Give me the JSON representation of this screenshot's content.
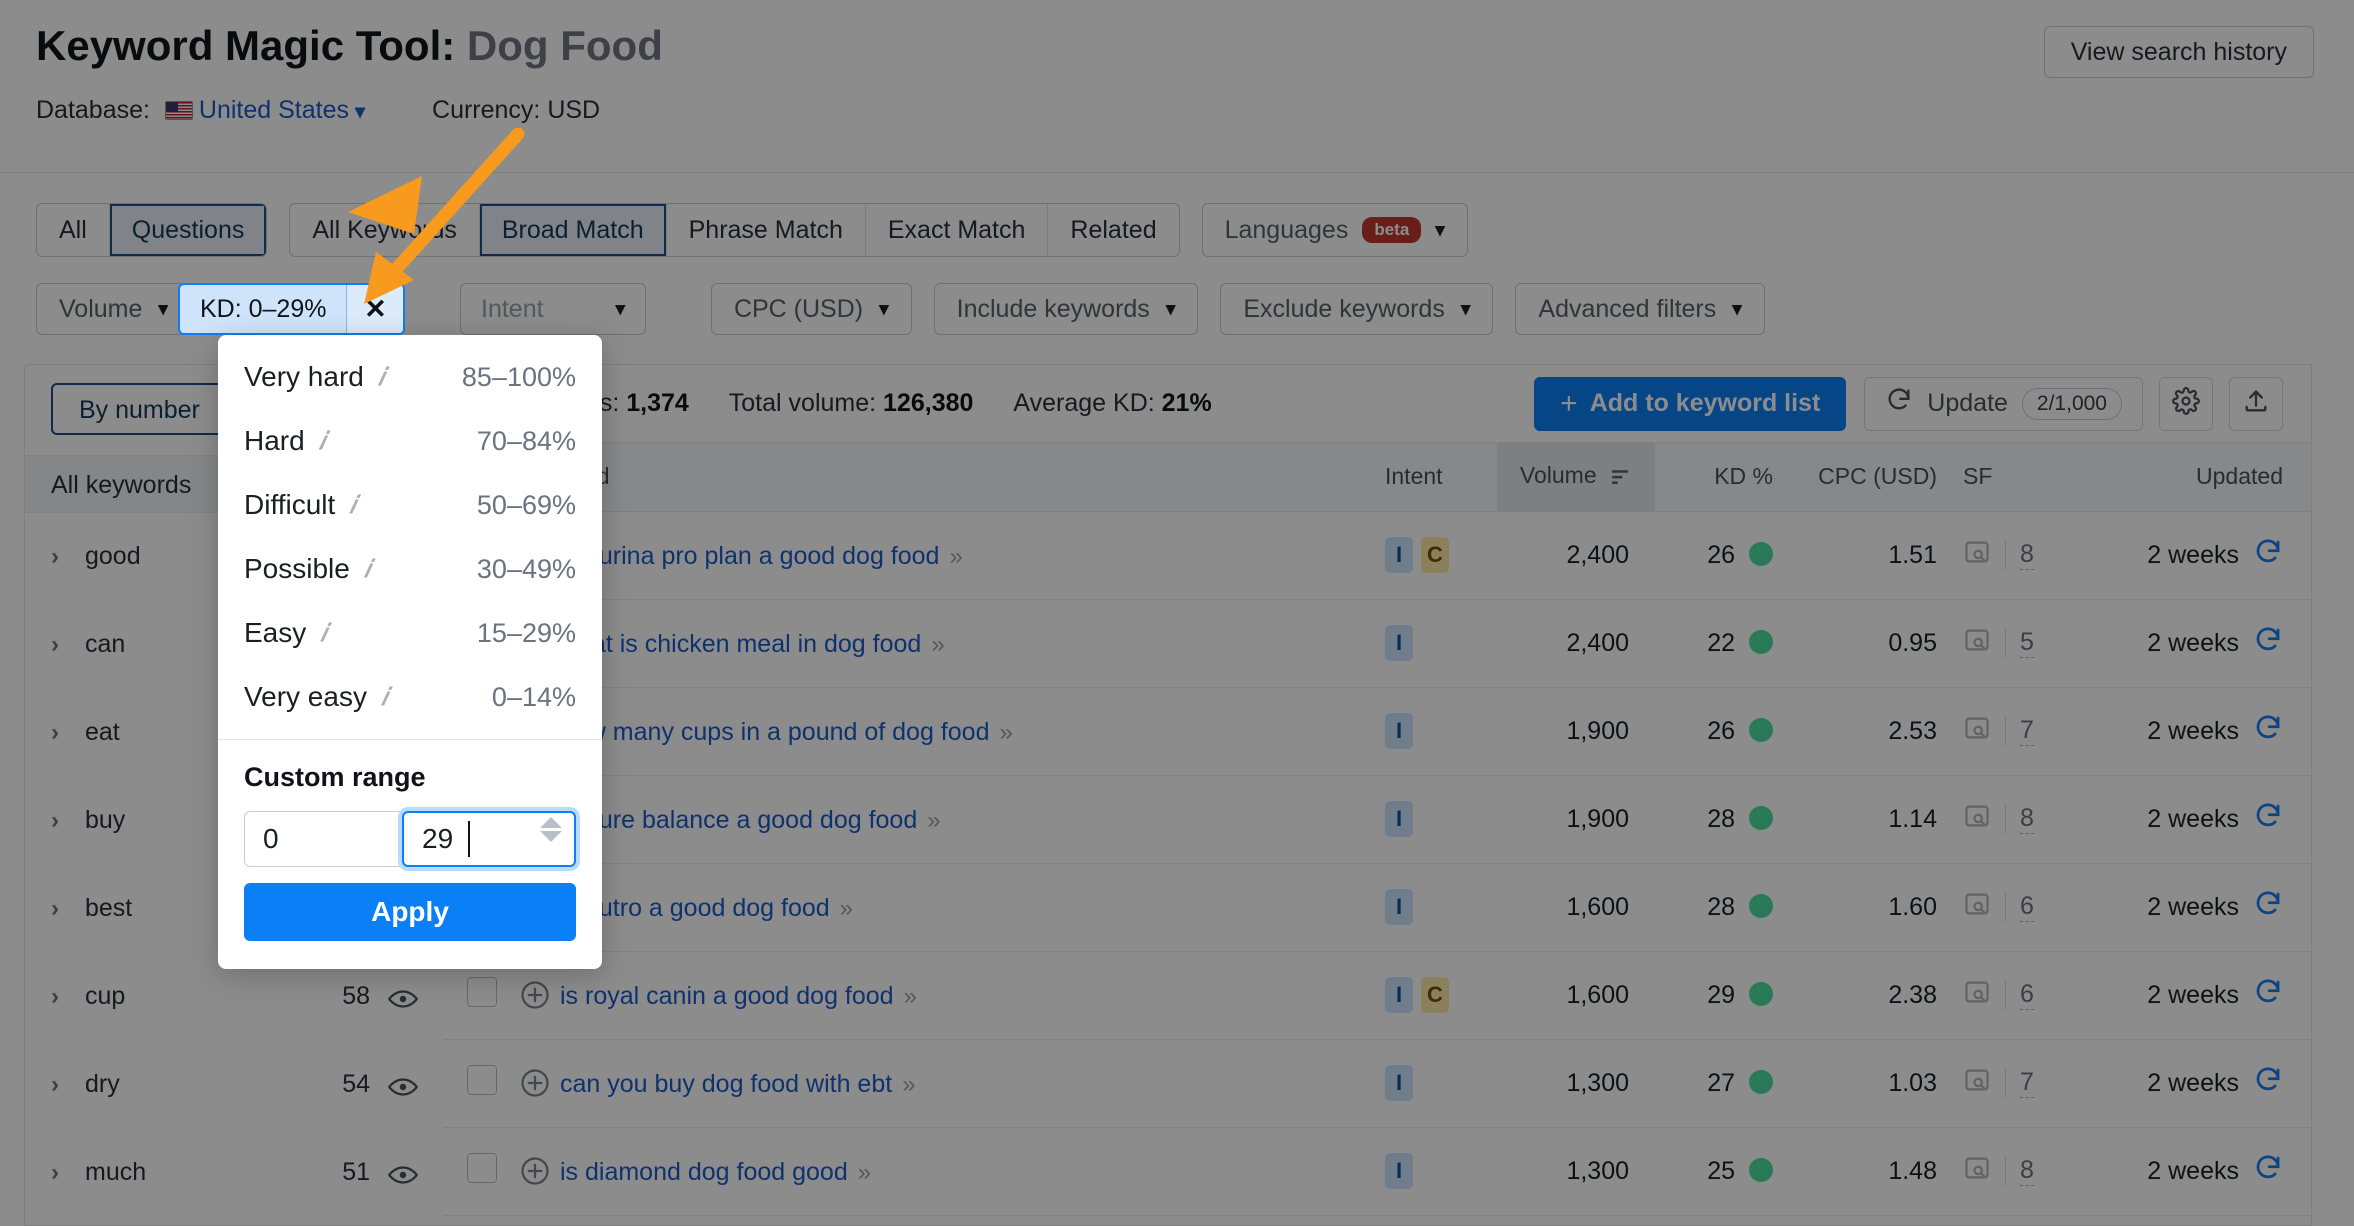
{
  "header": {
    "title_prefix": "Keyword Magic Tool:",
    "title_query": "Dog Food",
    "database_label": "Database:",
    "database_value": "United States",
    "currency_label": "Currency: USD",
    "view_history_label": "View search history",
    "flag_icon": "us-flag-icon"
  },
  "tabs": {
    "group1": [
      {
        "label": "All",
        "active": false
      },
      {
        "label": "Questions",
        "active": true
      }
    ],
    "group2": [
      {
        "label": "All Keywords",
        "active": false
      },
      {
        "label": "Broad Match",
        "active": true
      },
      {
        "label": "Phrase Match",
        "active": false
      },
      {
        "label": "Exact Match",
        "active": false
      },
      {
        "label": "Related",
        "active": false
      }
    ],
    "languages": {
      "label": "Languages",
      "badge": "beta"
    }
  },
  "filters": {
    "volume": "Volume",
    "kd_chip": "KD: 0–29%",
    "kd_chip_clear": "✕",
    "intent_placeholder": "Intent",
    "cpc": "CPC (USD)",
    "include": "Include keywords",
    "exclude": "Exclude keywords",
    "advanced": "Advanced filters"
  },
  "kd_dropdown": {
    "options": [
      {
        "name": "Very hard",
        "range": "85–100%"
      },
      {
        "name": "Hard",
        "range": "70–84%"
      },
      {
        "name": "Difficult",
        "range": "50–69%"
      },
      {
        "name": "Possible",
        "range": "30–49%"
      },
      {
        "name": "Easy",
        "range": "15–29%"
      },
      {
        "name": "Very easy",
        "range": "0–14%"
      }
    ],
    "custom_range_label": "Custom range",
    "min_value": "0",
    "max_value": "29",
    "apply_label": "Apply"
  },
  "sidebar": {
    "by_number_label": "By number",
    "all_keywords_label": "All keywords",
    "groups": [
      {
        "name": "good",
        "count": ""
      },
      {
        "name": "can",
        "count": ""
      },
      {
        "name": "eat",
        "count": ""
      },
      {
        "name": "buy",
        "count": ""
      },
      {
        "name": "best",
        "count": ""
      },
      {
        "name": "cup",
        "count": "58"
      },
      {
        "name": "dry",
        "count": "54"
      },
      {
        "name": "much",
        "count": "51"
      }
    ]
  },
  "summary": {
    "keywords_label": "All keywords:",
    "keywords_value": "1,374",
    "total_volume_label": "Total volume:",
    "total_volume_value": "126,380",
    "avg_kd_label": "Average KD:",
    "avg_kd_value": "21%",
    "add_to_list_label": "Add to keyword list",
    "update_label": "Update",
    "update_quota": "2/1,000",
    "settings_icon": "gear-icon",
    "export_icon": "export-icon"
  },
  "table": {
    "columns": [
      "Keyword",
      "Intent",
      "Volume",
      "KD %",
      "CPC (USD)",
      "SF",
      "Updated"
    ],
    "rows": [
      {
        "keyword": "is purina pro plan a good dog food",
        "intent": [
          "I",
          "C"
        ],
        "volume": "2,400",
        "kd": "26",
        "cpc": "1.51",
        "sf": "8",
        "updated": "2 weeks"
      },
      {
        "keyword": "what is chicken meal in dog food",
        "intent": [
          "I"
        ],
        "volume": "2,400",
        "kd": "22",
        "cpc": "0.95",
        "sf": "5",
        "updated": "2 weeks"
      },
      {
        "keyword": "how many cups in a pound of dog food",
        "intent": [
          "I"
        ],
        "volume": "1,900",
        "kd": "26",
        "cpc": "2.53",
        "sf": "7",
        "updated": "2 weeks"
      },
      {
        "keyword": "is pure balance a good dog food",
        "intent": [
          "I"
        ],
        "volume": "1,900",
        "kd": "28",
        "cpc": "1.14",
        "sf": "8",
        "updated": "2 weeks"
      },
      {
        "keyword": "is nutro a good dog food",
        "intent": [
          "I"
        ],
        "volume": "1,600",
        "kd": "28",
        "cpc": "1.60",
        "sf": "6",
        "updated": "2 weeks"
      },
      {
        "keyword": "is royal canin a good dog food",
        "intent": [
          "I",
          "C"
        ],
        "volume": "1,600",
        "kd": "29",
        "cpc": "2.38",
        "sf": "6",
        "updated": "2 weeks"
      },
      {
        "keyword": "can you buy dog food with ebt",
        "intent": [
          "I"
        ],
        "volume": "1,300",
        "kd": "27",
        "cpc": "1.03",
        "sf": "7",
        "updated": "2 weeks"
      },
      {
        "keyword": "is diamond dog food good",
        "intent": [
          "I"
        ],
        "volume": "1,300",
        "kd": "25",
        "cpc": "1.48",
        "sf": "8",
        "updated": "2 weeks"
      }
    ]
  },
  "colors": {
    "accent_blue": "#0b7ff5",
    "link_blue": "#1a5cc8",
    "kd_dot_green": "#4ddfa0",
    "intent_i_bg": "#cde4fb",
    "intent_c_bg": "#fde9a8",
    "annotation_orange": "#f79a1e"
  }
}
